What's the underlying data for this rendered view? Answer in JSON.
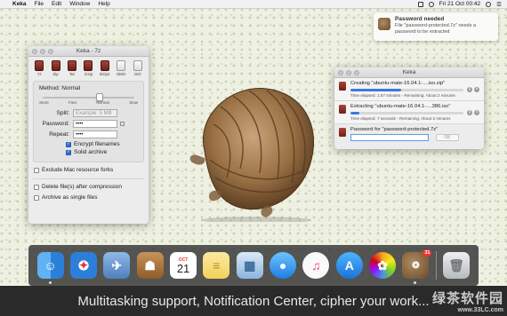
{
  "menubar": {
    "app": "Keka",
    "menus": [
      "File",
      "Edit",
      "Window",
      "Help"
    ],
    "clock": "Fri 21 Oct  00:42"
  },
  "notification": {
    "title": "Password needed",
    "body": "File \"password-protected.7z\" needs a password to be extracted"
  },
  "keka_window": {
    "title": "Keka - 7z",
    "formats": [
      "7z",
      "Zip",
      "Tar",
      "Gzip",
      "Bzip2",
      "DMG",
      "ISO"
    ],
    "method_label": "Method: Normal",
    "method_ticks": [
      "Store",
      "Fast",
      "Normal",
      "Slow"
    ],
    "split_label": "Split:",
    "split_placeholder": "Example: 5 MB",
    "password_label": "Password:",
    "password_value": "••••",
    "repeat_label": "Repeat:",
    "repeat_value": "••••",
    "encrypt_label": "Encrypt filenames",
    "encrypt_checked": true,
    "solid_label": "Solid archive",
    "solid_checked": true,
    "exclude_label": "Exclude Mac resource forks",
    "delete_label": "Delete file(s) after compression",
    "single_label": "Archive as single files"
  },
  "progress_window": {
    "title": "Keka",
    "tasks": [
      {
        "name": "Creating \"ubuntu-mate-16.04.1-....iso.zip\"",
        "status": "Time elapsed: 1.57 minutes - Remaining: About 2 minutes",
        "progress": 0.45
      },
      {
        "name": "Extracting \"ubuntu-mate-16.04.1-....386.iso\"",
        "status": "Time elapsed: 7 seconds - Remaining: About 2 minutes",
        "progress": 0.08
      }
    ],
    "password_prompt": "Password for \"password-protected.7z\"",
    "ok_label": "OK"
  },
  "dock": {
    "items": [
      {
        "name": "finder",
        "color": "#3a8ee6"
      },
      {
        "name": "safari",
        "color": "#2c7fd9"
      },
      {
        "name": "mail",
        "color": "#5b8fc7"
      },
      {
        "name": "contacts",
        "color": "#b07a3c"
      },
      {
        "name": "calendar",
        "color": "#ffffff"
      },
      {
        "name": "notes",
        "color": "#f6e58d"
      },
      {
        "name": "preview",
        "color": "#8ab5de"
      },
      {
        "name": "messages",
        "color": "#3d9bf5"
      },
      {
        "name": "itunes",
        "color": "#f2f2f2"
      },
      {
        "name": "app-store",
        "color": "#2b8be0"
      },
      {
        "name": "photos",
        "color": "#ffffff"
      },
      {
        "name": "keka",
        "color": "#7a5a3a"
      },
      {
        "name": "trash",
        "color": "#bfc2c4"
      }
    ],
    "calendar_month": "OCT",
    "calendar_day": "21",
    "keka_badge": "31"
  },
  "caption": "Multitasking support, Notification Center, cipher your work...",
  "watermark": {
    "line1": "绿茶软件园",
    "line2": "www.33LC.com"
  }
}
